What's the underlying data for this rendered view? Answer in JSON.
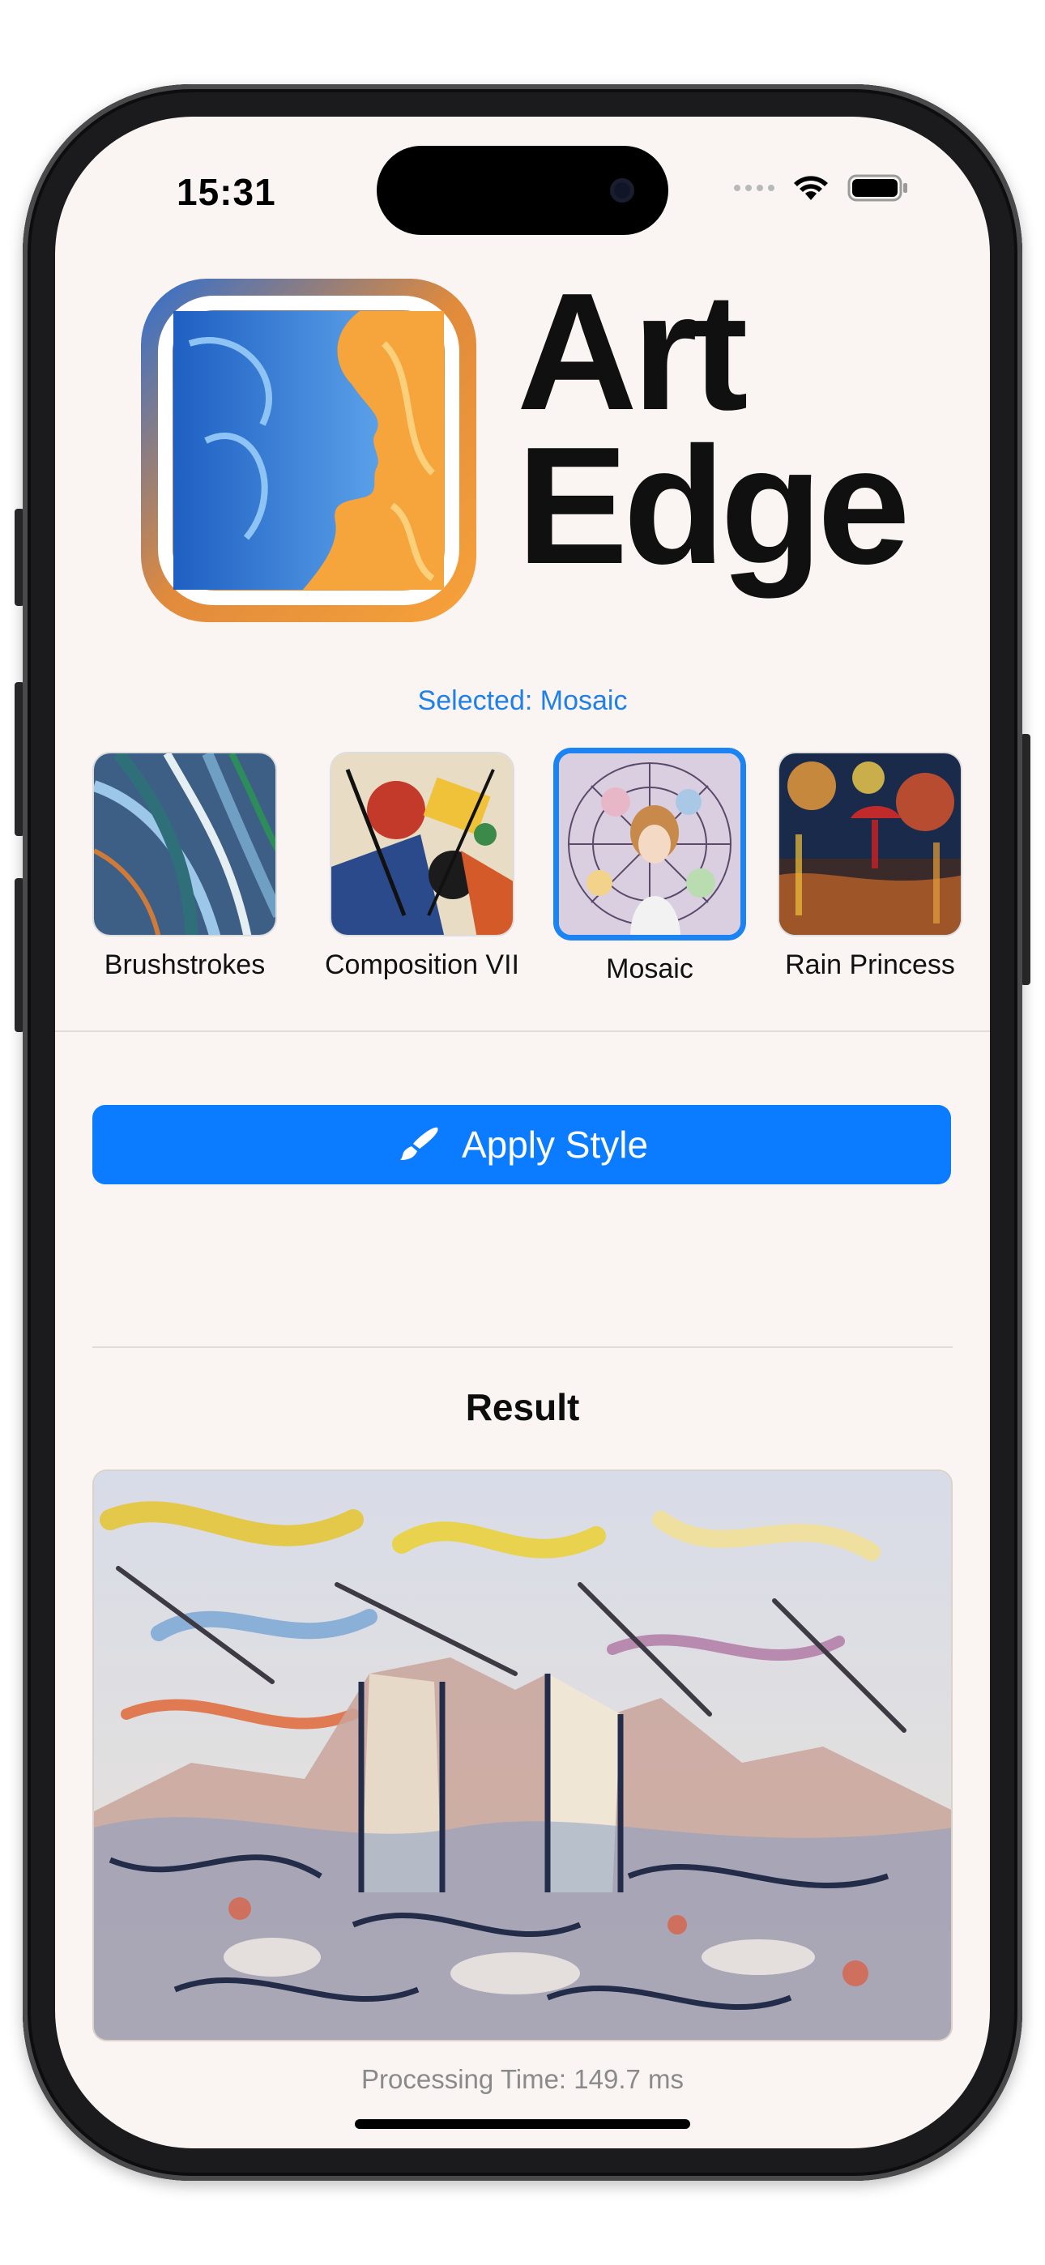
{
  "status_bar": {
    "time": "15:31"
  },
  "app": {
    "title_line1": "Art",
    "title_line2": "Edge",
    "logo_icon": "face-painting-logo"
  },
  "selection": {
    "label": "Selected: Mosaic"
  },
  "styles": [
    {
      "name": "Brushstrokes",
      "selected": false
    },
    {
      "name": "Composition VII",
      "selected": false
    },
    {
      "name": "Mosaic",
      "selected": true
    },
    {
      "name": "Rain Princess",
      "selected": false
    }
  ],
  "apply_button": {
    "label": "Apply Style",
    "icon": "paintbrush-icon"
  },
  "result": {
    "title": "Result",
    "processing_time": "Processing Time: 149.7 ms"
  },
  "colors": {
    "accent": "#0B7CFF",
    "background": "#FAF5F2",
    "selected_text": "#1F80E8"
  }
}
